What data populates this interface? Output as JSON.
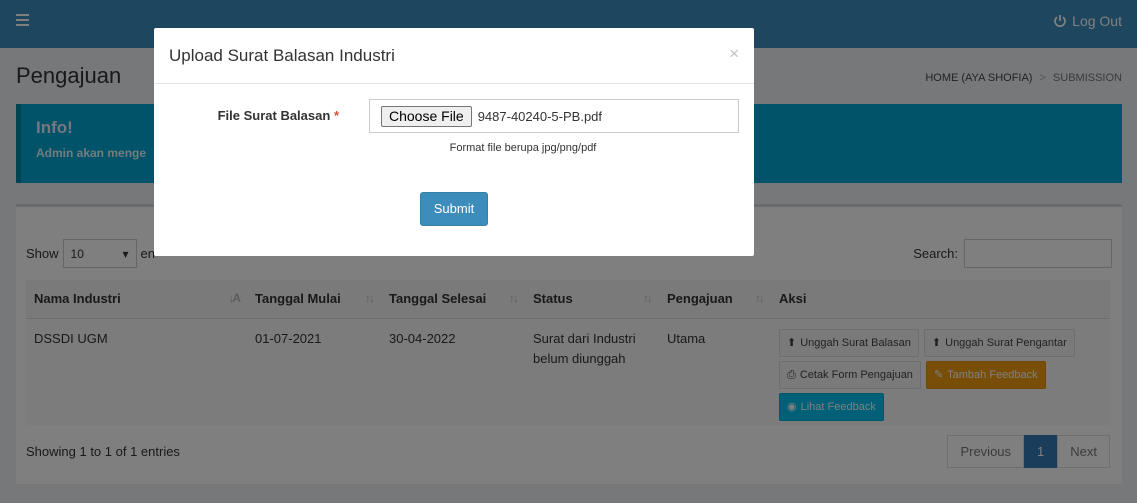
{
  "header": {
    "logout_label": "Log Out"
  },
  "page": {
    "title": "Pengajuan",
    "breadcrumb": [
      "HOME (AYA SHOFIA)",
      ">",
      "SUBMISSION"
    ]
  },
  "callout": {
    "title": "Info!",
    "text": "Admin akan menge"
  },
  "table": {
    "length_label_before": "Show",
    "length_value": "10",
    "length_label_after": "en",
    "search_label": "Search:",
    "columns": [
      "Nama Industri",
      "Tanggal Mulai",
      "Tanggal Selesai",
      "Status",
      "Pengajuan",
      "Aksi"
    ],
    "rows": [
      {
        "nama_industri": "DSSDI UGM",
        "tanggal_mulai": "01-07-2021",
        "tanggal_selesai": "30-04-2022",
        "status_line1": "Surat dari Industri",
        "status_line2": "belum diunggah",
        "pengajuan": "Utama",
        "actions": {
          "unggah_balasan": "Unggah Surat Balasan",
          "unggah_pengantar": "Unggah Surat Pengantar",
          "cetak_form": "Cetak Form Pengajuan",
          "tambah_feedback": "Tambah Feedback",
          "lihat_feedback": "Lihat Feedback"
        }
      }
    ],
    "info": "Showing 1 to 1 of 1 entries",
    "pagination": {
      "previous": "Previous",
      "current": "1",
      "next": "Next"
    }
  },
  "modal": {
    "title": "Upload Surat Balasan Industri",
    "close": "×",
    "field_label": "File Surat Balasan",
    "required_mark": "*",
    "choose_file_label": "Choose File",
    "file_name": "9487-40240-5-PB.pdf",
    "help_text": "Format file berupa jpg/png/pdf",
    "submit_label": "Submit"
  },
  "colors": {
    "topbar": "#3c8dbc",
    "callout": "#00a7d0",
    "warning": "#f39c12",
    "info": "#00c0ef",
    "primary": "#3c8dbc"
  }
}
